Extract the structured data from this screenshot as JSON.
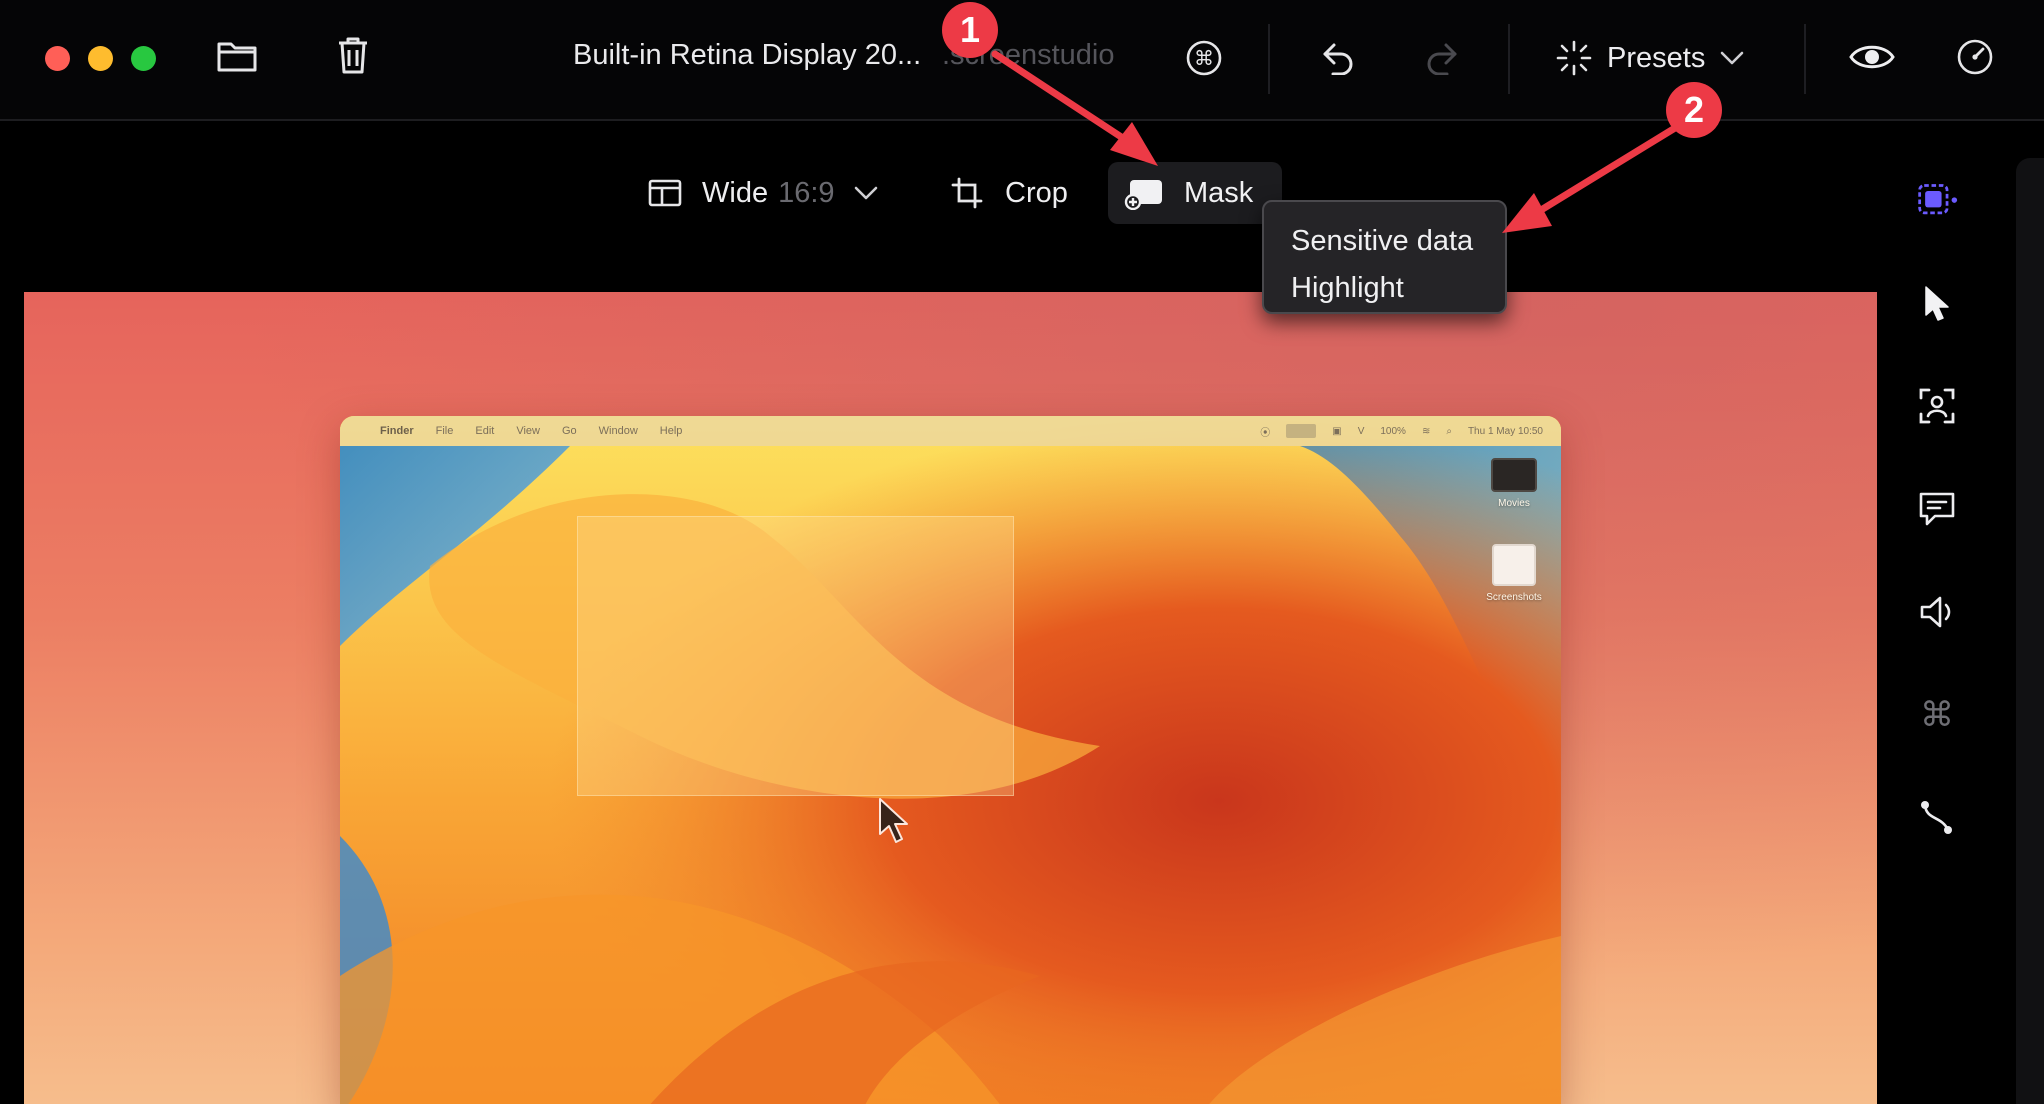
{
  "window": {
    "title": "Built-in Retina Display 20...",
    "title_ext": ".screenstudio",
    "presets_label": "Presets"
  },
  "toolbar": {
    "aspect_label": "Wide",
    "aspect_ratio": "16:9",
    "crop_label": "Crop",
    "mask_label": "Mask"
  },
  "mask_menu": {
    "items": [
      "Sensitive data",
      "Highlight"
    ]
  },
  "recording": {
    "menubar_items": [
      "Finder",
      "File",
      "Edit",
      "View",
      "Go",
      "Window",
      "Help"
    ],
    "menubar_right": "Thu 1 May 10:50",
    "menubar_battery": "100%",
    "desktop_icons": [
      "Movies",
      "Screenshots"
    ]
  },
  "annotations": {
    "badge1": "1",
    "badge2": "2",
    "color": "#ed3a46"
  },
  "icons": {
    "folder": "folder-icon",
    "trash": "trash-icon",
    "shortcut": "command-icon",
    "undo": "undo-icon",
    "redo": "redo-icon",
    "presets": "sparkle-icon",
    "preview": "eye-icon",
    "speed": "speedometer-icon",
    "sidebar": [
      "selection-icon",
      "cursor-icon",
      "camera-person-icon",
      "captions-icon",
      "audio-icon",
      "keyboard-shortcut-icon",
      "motion-path-icon"
    ]
  },
  "colors": {
    "accent": "#6b5bff",
    "traffic_red": "#ff5f57",
    "traffic_yellow": "#febc2e",
    "traffic_green": "#28c840"
  }
}
